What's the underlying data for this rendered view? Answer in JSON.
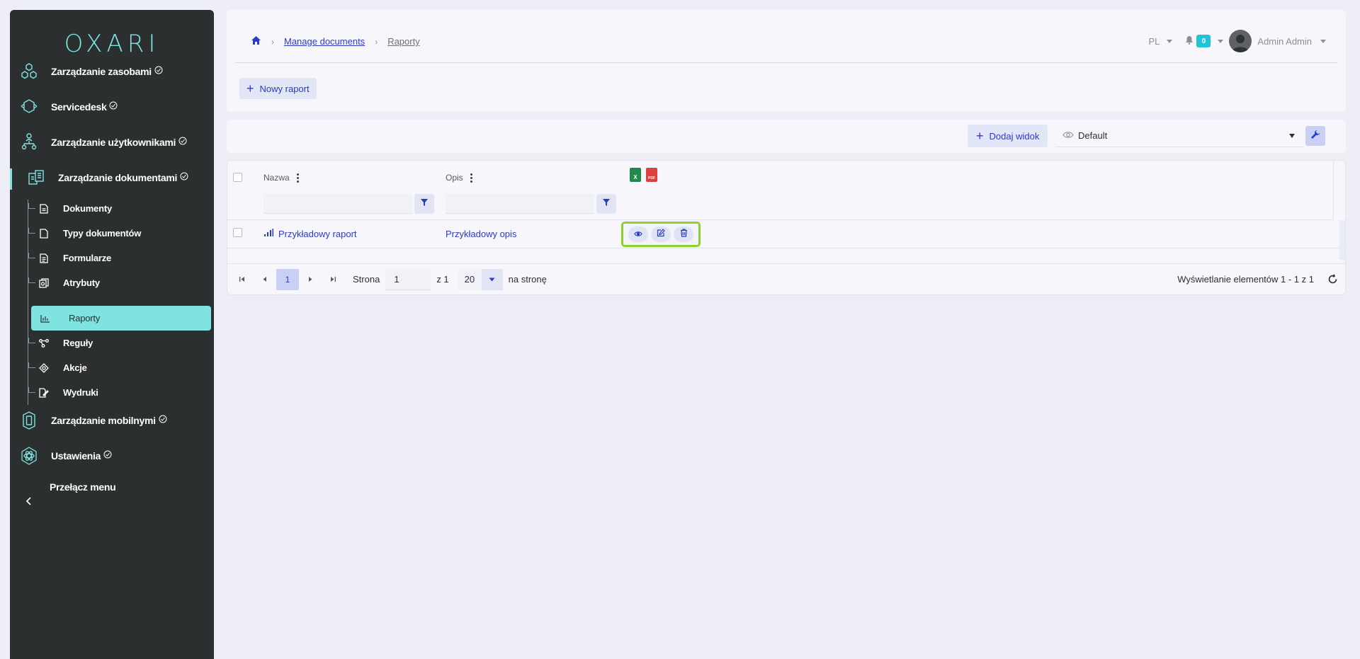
{
  "app": {
    "logo": "OXARI",
    "accent": "#7fe3e0",
    "link_color": "#2a3bc7",
    "highlight_color": "#8bd22e"
  },
  "sidebar": {
    "main_items": [
      {
        "label": "Zarządzanie zasobami",
        "icon": "hexagons-icon"
      },
      {
        "label": "Servicedesk",
        "icon": "servicedesk-icon"
      },
      {
        "label": "Zarządzanie użytkownikami",
        "icon": "users-tree-icon"
      },
      {
        "label": "Zarządzanie dokumentami",
        "icon": "documents-icon"
      },
      {
        "label": "Zarządzanie mobilnymi",
        "icon": "mobile-icon"
      },
      {
        "label": "Ustawienia",
        "icon": "settings-atom-icon"
      }
    ],
    "sub_items": [
      {
        "label": "Dokumenty",
        "icon": "document-icon"
      },
      {
        "label": "Typy dokumentów",
        "icon": "document-type-icon"
      },
      {
        "label": "Formularze",
        "icon": "form-icon"
      },
      {
        "label": "Atrybuty",
        "icon": "attributes-icon"
      },
      {
        "label": "Raporty",
        "icon": "report-icon"
      },
      {
        "label": "Reguły",
        "icon": "rules-icon"
      },
      {
        "label": "Akcje",
        "icon": "actions-icon"
      },
      {
        "label": "Wydruki",
        "icon": "print-icon"
      }
    ],
    "toggle_label": "Przełącz menu"
  },
  "header": {
    "breadcrumb": {
      "home_icon": "home-icon",
      "level1": "Manage documents",
      "current": "Raporty"
    },
    "language": "PL",
    "notifications_count": "0",
    "user_name": "Admin Admin",
    "new_report_label": "Nowy raport"
  },
  "toolbar": {
    "add_view_label": "Dodaj widok",
    "view_selected": "Default"
  },
  "table": {
    "columns": [
      "Nazwa",
      "Opis"
    ],
    "export": {
      "excel": "X",
      "pdf": "PDF"
    },
    "rows": [
      {
        "name": "Przykładowy raport",
        "description": "Przykładowy opis"
      }
    ]
  },
  "pager": {
    "current_page": "1",
    "page_label": "Strona",
    "page_input": "1",
    "of_label": "z 1",
    "page_size": "20",
    "per_page_label": "na stronę",
    "info": "Wyświetlanie elementów 1 - 1 z 1"
  }
}
